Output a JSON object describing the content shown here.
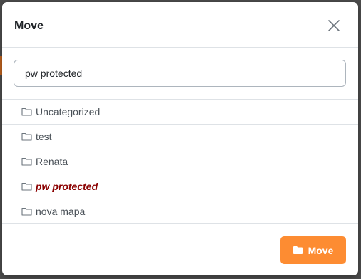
{
  "dialog": {
    "title": "Move",
    "close_icon": "close-icon"
  },
  "search": {
    "value": "pw protected",
    "placeholder": ""
  },
  "folders": [
    {
      "label": "Uncategorized",
      "icon": "folder-outline-icon",
      "selected": false
    },
    {
      "label": "test",
      "icon": "folder-outline-icon",
      "selected": false
    },
    {
      "label": "Renata",
      "icon": "folder-outline-icon",
      "selected": false
    },
    {
      "label": "pw protected",
      "icon": "folder-outline-icon",
      "selected": true
    },
    {
      "label": "nova mapa",
      "icon": "folder-outline-icon",
      "selected": false
    }
  ],
  "footer": {
    "move_label": "Move",
    "move_icon": "folder-solid-icon"
  },
  "colors": {
    "accent": "#fd8c32",
    "selected_text": "#8b0000",
    "text": "#495057",
    "border": "#dee2e6"
  }
}
